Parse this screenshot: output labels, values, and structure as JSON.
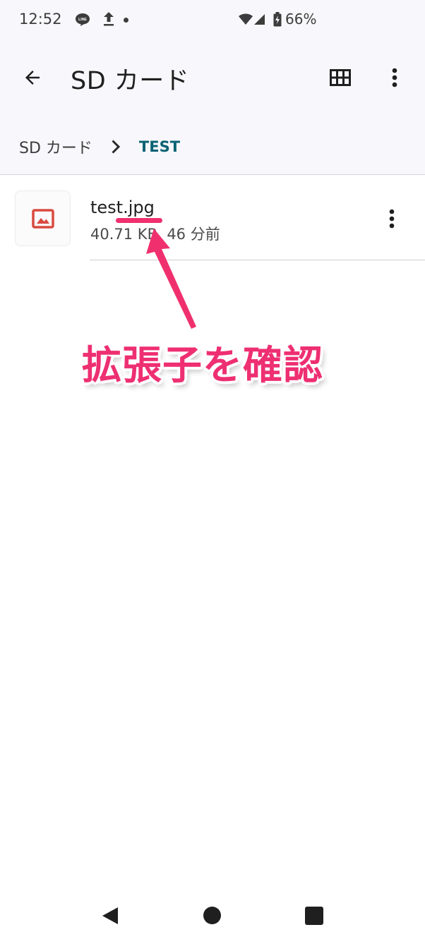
{
  "status_bar": {
    "time": "12:52",
    "line_badge": "LINE",
    "battery_percent": "66%"
  },
  "app_bar": {
    "title": "SD カード"
  },
  "breadcrumb": {
    "root": "SD カード",
    "current": "TEST"
  },
  "files": [
    {
      "name": "test.jpg",
      "meta": "40.71 KB, 46 分前"
    }
  ],
  "annotation": {
    "text": "拡張子を確認",
    "color": "#ee2f72"
  },
  "colors": {
    "accent": "#0b6273",
    "image_icon": "#d94a3f"
  }
}
